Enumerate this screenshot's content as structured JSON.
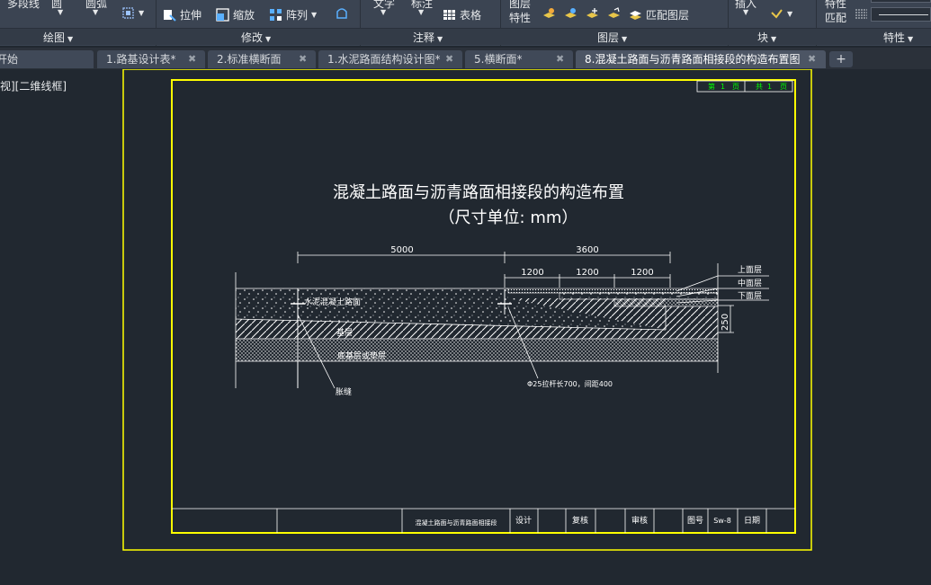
{
  "ribbon": {
    "draw": {
      "polyline": "多段线",
      "circle": "圆",
      "arc": "圆弧"
    },
    "modify": {
      "stretch": "拉伸",
      "scale": "缩放",
      "array": "阵列"
    },
    "annotation": {
      "text": "文字",
      "dimension": "标注",
      "table": "表格"
    },
    "layers": {
      "layer_properties_line1": "图层",
      "layer_properties_line2": "特性",
      "match_layer": "匹配图层"
    },
    "block": {
      "insert": "插入"
    },
    "properties": {
      "match_line1": "特性",
      "match_line2": "匹配"
    },
    "panels": {
      "draw": "绘图",
      "modify": "修改",
      "annotation": "注释",
      "layers": "图层",
      "block": "块",
      "properties": "特性"
    }
  },
  "tabs": [
    {
      "label": "开始"
    },
    {
      "label": "1.路基设计表*"
    },
    {
      "label": "2.标准横断面"
    },
    {
      "label": "1.水泥路面结构设计图*"
    },
    {
      "label": "5.横断面*"
    },
    {
      "label": "8.混凝土路面与沥青路面相接段的构造布置图",
      "active": true
    }
  ],
  "view_label": "视][二维线框]",
  "drawing": {
    "sheet_no": {
      "label1": "第",
      "value1": "1",
      "unit1": "页",
      "label2": "共",
      "value2": "1",
      "unit2": "页"
    },
    "title": "混凝土路面与沥青路面相接段的构造布置",
    "subtitle": "（尺寸单位: mm）",
    "dims": {
      "left": "5000",
      "right": "3600",
      "seg1": "1200",
      "seg2": "1200",
      "seg3": "1200",
      "vertical": "250"
    },
    "labels": {
      "concrete": "水泥混凝土路面",
      "base": "基层",
      "subbase": "底基层或垫层",
      "joint": "胀缝",
      "upper": "上面层",
      "middle": "中面层",
      "lower": "下面层",
      "rebar": "Φ25拉杆长700，间距400"
    },
    "titleblock": {
      "name": "混凝土路面与沥青路面相接段",
      "design": "设计",
      "check": "复核",
      "review": "审核",
      "drawing_no_label": "图号",
      "drawing_no": "Sw-8",
      "date": "日期"
    }
  },
  "colors": {
    "frame": "#ffff00",
    "line": "#ffffff",
    "green_text": "#00ff00",
    "background": "#212830",
    "ribbon": "#3b4452"
  }
}
